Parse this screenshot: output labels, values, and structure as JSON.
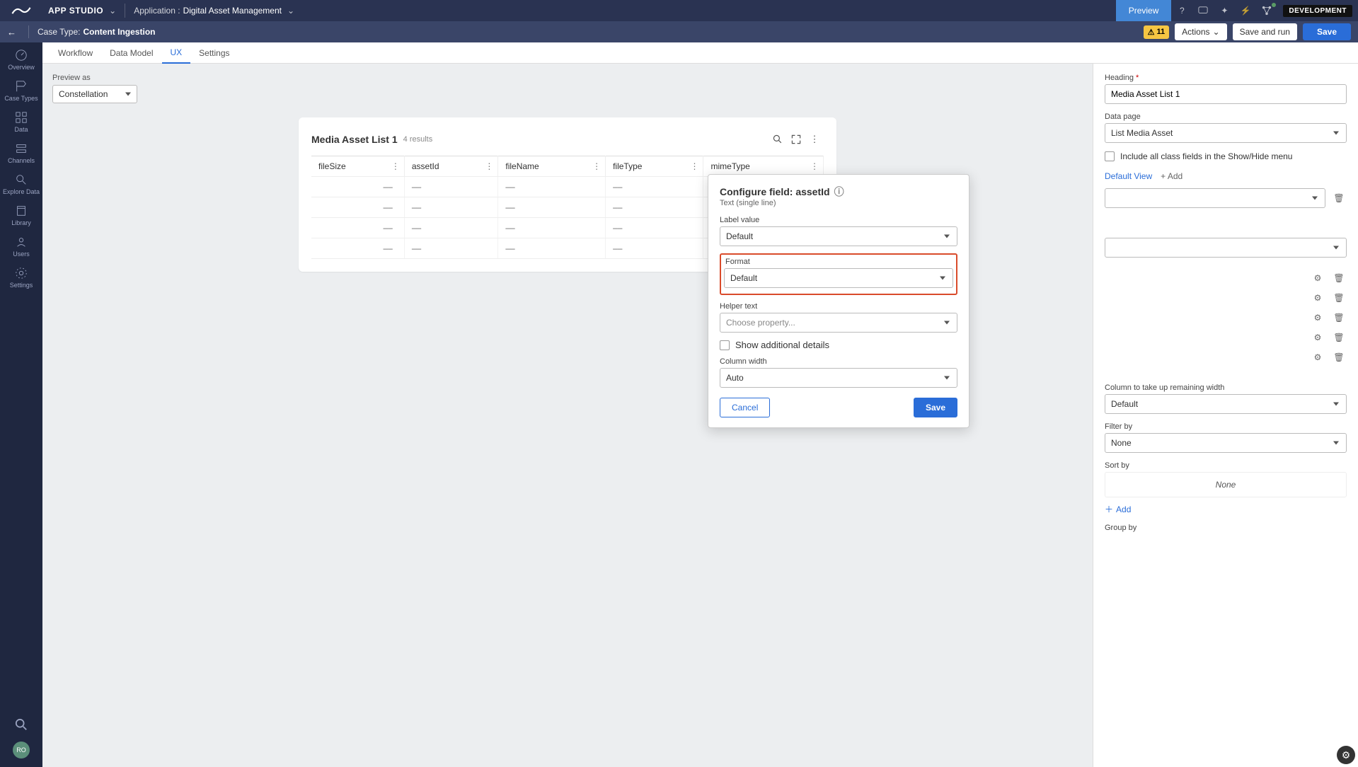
{
  "topbar": {
    "studio": "APP STUDIO",
    "app_prefix": "Application :",
    "app_name": "Digital Asset Management",
    "preview": "Preview",
    "env": "DEVELOPMENT"
  },
  "secondbar": {
    "case_prefix": "Case Type:",
    "case_name": "Content Ingestion",
    "warn_count": "11",
    "actions": "Actions",
    "save_run": "Save and run",
    "save": "Save"
  },
  "leftrail": {
    "items": [
      {
        "label": "Overview"
      },
      {
        "label": "Case Types"
      },
      {
        "label": "Data"
      },
      {
        "label": "Channels"
      },
      {
        "label": "Explore Data"
      },
      {
        "label": "Library"
      },
      {
        "label": "Users"
      },
      {
        "label": "Settings"
      }
    ],
    "avatar": "RO"
  },
  "tabs": {
    "items": [
      "Workflow",
      "Data Model",
      "UX",
      "Settings"
    ],
    "active": "UX"
  },
  "canvas": {
    "preview_as_label": "Preview as",
    "preview_as_value": "Constellation",
    "card_title": "Media Asset List 1",
    "card_subtitle": "4 results",
    "columns": [
      "fileSize",
      "assetId",
      "fileName",
      "fileType",
      "mimeType"
    ],
    "rows": [
      [
        "––",
        "––",
        "––",
        "––",
        "––"
      ],
      [
        "––",
        "––",
        "––",
        "––",
        "––"
      ],
      [
        "––",
        "––",
        "––",
        "––",
        "––"
      ],
      [
        "––",
        "––",
        "––",
        "––",
        "––"
      ]
    ]
  },
  "rightpanel": {
    "heading_label": "Heading",
    "heading_value": "Media Asset List 1",
    "datapage_label": "Data page",
    "datapage_value": "List Media Asset",
    "include_label": "Include all class fields in the Show/Hide menu",
    "default_view": "Default View",
    "add_view": "+ Add",
    "column_remaining_label": "Column to take up remaining width",
    "column_remaining_value": "Default",
    "filter_label": "Filter by",
    "filter_value": "None",
    "sort_label": "Sort by",
    "sort_none": "None",
    "add_label": "Add",
    "group_label": "Group by"
  },
  "popover": {
    "title": "Configure field: assetId",
    "sub": "Text (single line)",
    "label_value_label": "Label value",
    "label_value": "Default",
    "format_label": "Format",
    "format_value": "Default",
    "helper_label": "Helper text",
    "helper_value": "Choose property...",
    "show_additional": "Show additional details",
    "colwidth_label": "Column width",
    "colwidth_value": "Auto",
    "cancel": "Cancel",
    "save": "Save"
  }
}
